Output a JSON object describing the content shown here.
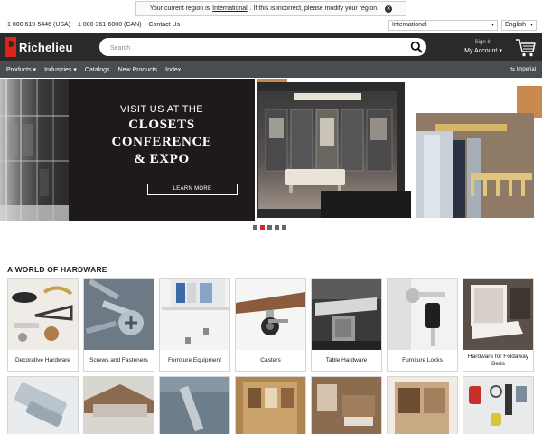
{
  "region_notice": {
    "text_before": "Your current region is",
    "region_link": "International",
    "text_after": ". If this is incorrect, please modify your region."
  },
  "utility": {
    "phone_usa": "1 800 619-5446 (USA)",
    "phone_can": "1 800 361-6000 (CAN)",
    "contact": "Contact Us",
    "region_value": "International",
    "language_value": "English"
  },
  "header": {
    "logo_text": "Richelieu",
    "search_placeholder": "Search",
    "sign_in": "Sign In",
    "my_account": "My Account"
  },
  "nav": {
    "items": [
      "Products",
      "Industries",
      "Catalogs",
      "New Products",
      "Index"
    ],
    "unit": "Imperial"
  },
  "banner": {
    "line1": "VISIT US AT THE",
    "line2": "CLOSETS",
    "line3": "CONFERENCE",
    "line4": "& EXPO",
    "cta": "LEARN MORE",
    "dots": 5,
    "active_dot": 1
  },
  "section": {
    "title": "A WORLD OF HARDWARE",
    "tiles": [
      {
        "label": "Decorative Hardware"
      },
      {
        "label": "Screws and Fasteners"
      },
      {
        "label": "Furniture Equipment"
      },
      {
        "label": "Casters"
      },
      {
        "label": "Table Hardware"
      },
      {
        "label": "Furniture Locks"
      },
      {
        "label": "Hardware for Foldaway Beds"
      }
    ]
  },
  "colors": {
    "brand_red": "#d8261c",
    "header_dark": "#2a2a2a",
    "nav_gray": "#4a4d50"
  }
}
